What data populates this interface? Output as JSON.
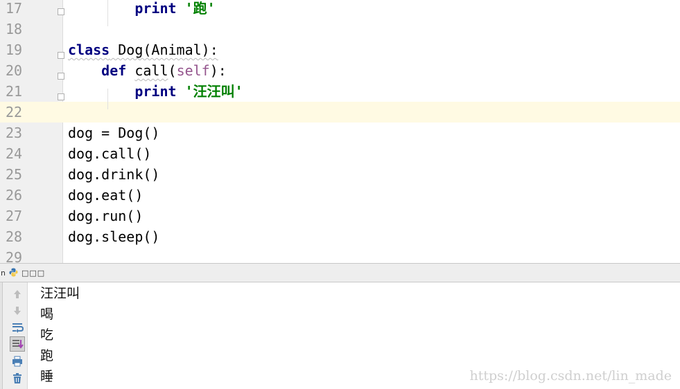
{
  "editor": {
    "lines": [
      {
        "num": "17",
        "parts": [
          {
            "t": "        "
          },
          {
            "t": "print",
            "c": "kw"
          },
          {
            "t": " "
          },
          {
            "t": "'跑'",
            "c": "str"
          }
        ]
      },
      {
        "num": "18",
        "parts": []
      },
      {
        "num": "19",
        "parts": [
          {
            "t": "class",
            "c": "kw squig"
          },
          {
            "t": " Dog(Animal):",
            "c": "squig"
          }
        ]
      },
      {
        "num": "20",
        "parts": [
          {
            "t": "    "
          },
          {
            "t": "def",
            "c": "kw"
          },
          {
            "t": " "
          },
          {
            "t": "call",
            "c": "squig"
          },
          {
            "t": "("
          },
          {
            "t": "self",
            "c": "self"
          },
          {
            "t": "):"
          }
        ]
      },
      {
        "num": "21",
        "parts": [
          {
            "t": "        "
          },
          {
            "t": "print",
            "c": "kw"
          },
          {
            "t": " "
          },
          {
            "t": "'汪汪叫'",
            "c": "str"
          }
        ]
      },
      {
        "num": "22",
        "parts": [],
        "current": true
      },
      {
        "num": "23",
        "parts": [
          {
            "t": "dog = Dog()"
          }
        ]
      },
      {
        "num": "24",
        "parts": [
          {
            "t": "dog.call()"
          }
        ]
      },
      {
        "num": "25",
        "parts": [
          {
            "t": "dog.drink()"
          }
        ]
      },
      {
        "num": "26",
        "parts": [
          {
            "t": "dog.eat()"
          }
        ]
      },
      {
        "num": "27",
        "parts": [
          {
            "t": "dog.run()"
          }
        ]
      },
      {
        "num": "28",
        "parts": [
          {
            "t": "dog.sleep()"
          }
        ]
      },
      {
        "num": "29",
        "parts": []
      }
    ]
  },
  "run_panel": {
    "prefix": "n",
    "config_name": "□□□",
    "tools": [
      "up-arrow-icon",
      "down-arrow-icon",
      "soft-wrap-icon",
      "scroll-to-end-icon",
      "print-icon",
      "trash-icon"
    ]
  },
  "console": {
    "output": [
      "汪汪叫",
      "喝",
      "吃",
      "跑",
      "睡"
    ]
  },
  "watermark": "https://blog.csdn.net/lin_made"
}
